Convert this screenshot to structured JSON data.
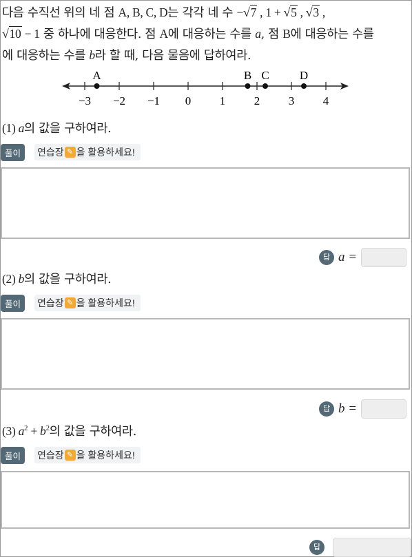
{
  "problem": {
    "part1": "다음 수직선 위의 네 점 ",
    "points": "A, B, C, D",
    "part2": "는 각각 네 수 ",
    "minus": "−",
    "n7": "7",
    "comma1": " , ",
    "one_plus": "1 + ",
    "n5": "5",
    "comma2": " , ",
    "n3": "3",
    "comma3": " ,",
    "n10": "10",
    "minus_one": " − 1",
    "part3": " 중 하나에 대응한다. 점 ",
    "pA": "A",
    "part4": "에 대응하는 수를 ",
    "va": "a",
    "part5": ", 점 ",
    "pB": "B",
    "part6": "에 대응하는 수를 ",
    "vb": "b",
    "part7": "라 할 때, 다음 물음에 답하여라."
  },
  "number_line": {
    "ticks": [
      "−3",
      "−2",
      "−1",
      "0",
      "1",
      "2",
      "3",
      "4"
    ],
    "tick_values": [
      -3,
      -2,
      -1,
      0,
      1,
      2,
      3,
      4
    ],
    "points": [
      {
        "label": "A",
        "value": -2.65
      },
      {
        "label": "B",
        "value": 1.73
      },
      {
        "label": "C",
        "value": 2.24
      },
      {
        "label": "D",
        "value": 3.36
      }
    ]
  },
  "questions": [
    {
      "num": "(1) ",
      "var": "a",
      "text": "의 값을 구하여라."
    },
    {
      "num": "(2) ",
      "var": "b",
      "text": "의 값을 구하여라."
    },
    {
      "num": "(3) ",
      "expr_a": "a",
      "sup1": "2",
      "plus": " + ",
      "expr_b": "b",
      "sup2": "2",
      "text": "의 값을 구하여라."
    }
  ],
  "solution_label": "풀이",
  "practice_text_pre": "연습장",
  "practice_text_post": "을 활용하세요!",
  "answer_badge": "답",
  "answers": [
    {
      "label": "a =",
      "value": ""
    },
    {
      "label": "b =",
      "value": ""
    },
    {
      "label": "",
      "value": ""
    }
  ],
  "colors": {
    "badge": "#536975",
    "pencil": "#f3a933",
    "border": "#b8b8b8"
  }
}
